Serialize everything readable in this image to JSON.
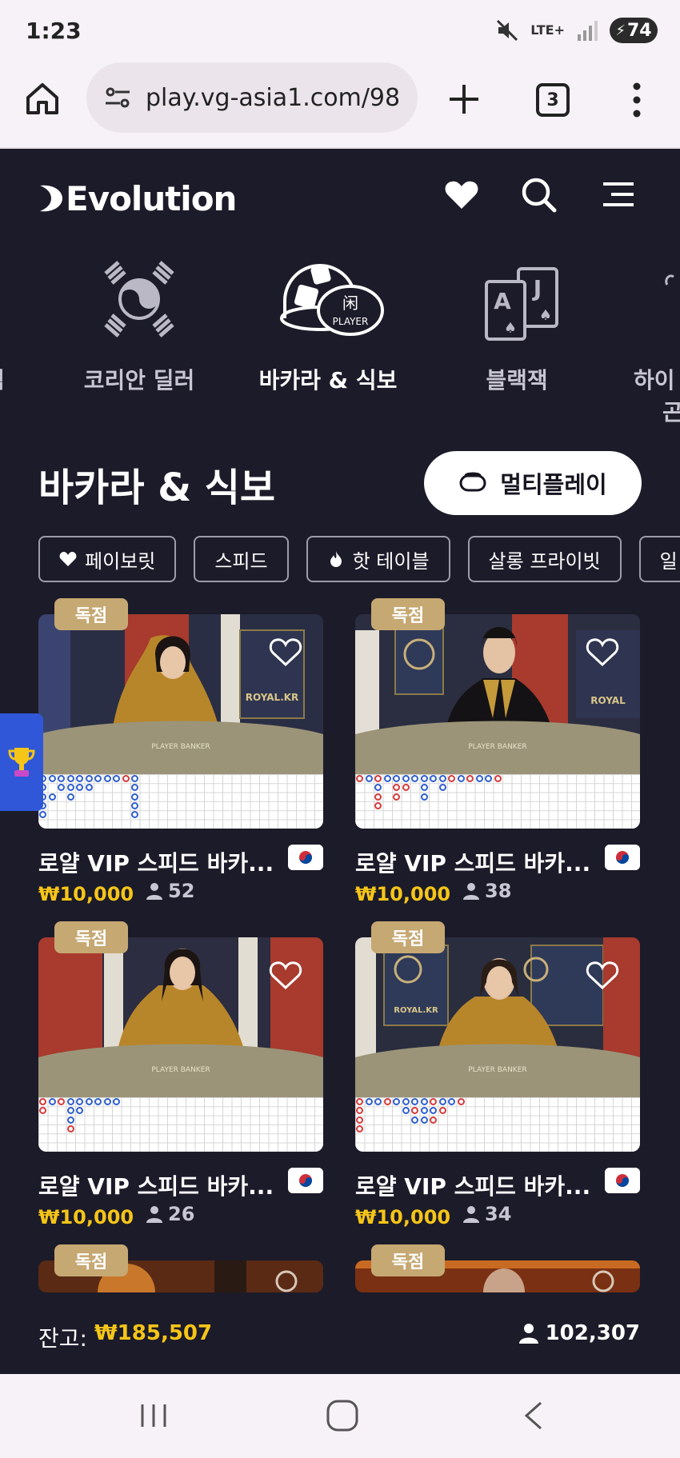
{
  "status_bar": {
    "time": "1:23",
    "network": "LTE+",
    "battery": "74"
  },
  "browser": {
    "url": "play.vg-asia1.com/98",
    "tab_count": "3"
  },
  "header": {
    "brand": "Evolution"
  },
  "categories": [
    {
      "label": "임",
      "icon": "partial-icon"
    },
    {
      "label": "코리안 딜러",
      "icon": "taegeuk-icon"
    },
    {
      "label": "바카라 & 식보",
      "icon": "dice-baccarat-icon",
      "active": true
    },
    {
      "label": "블랙잭",
      "icon": "cards-icon"
    },
    {
      "label": "하이",
      "label2": "곤",
      "icon": "partial-icon"
    }
  ],
  "section": {
    "title": "바카라 & 식보",
    "multiplay": "멀티플레이"
  },
  "filters": [
    "페이보릿",
    "스피드",
    "핫 테이블",
    "살롱 프라이빗",
    "일"
  ],
  "tables": [
    {
      "badge": "독점",
      "title": "로얄 VIP 스피드 바카...",
      "min_bet": "₩10,000",
      "players": "52",
      "studio_sign": "ROYAL.KR",
      "table_text": "PLAYER  BANKER"
    },
    {
      "badge": "독점",
      "title": "로얄 VIP 스피드 바카...",
      "min_bet": "₩10,000",
      "players": "38",
      "studio_sign": "ROYAL",
      "table_text": "PLAYER  BANKER"
    },
    {
      "badge": "독점",
      "title": "로얄 VIP 스피드 바카...",
      "min_bet": "₩10,000",
      "players": "26",
      "studio_sign": "",
      "table_text": "PLAYER  BANKER"
    },
    {
      "badge": "독점",
      "title": "로얄 VIP 스피드 바카...",
      "min_bet": "₩10,000",
      "players": "34",
      "studio_sign": "ROYAL.KR",
      "table_text": "PLAYER  BANKER"
    },
    {
      "badge": "독점"
    },
    {
      "badge": "독점"
    }
  ],
  "footer": {
    "balance_label": "잔고:",
    "balance": "₩185,507",
    "online_players": "102,307"
  },
  "colors": {
    "background": "#1c1b29",
    "accent_gold": "#f5c518",
    "badge": "#c6a873",
    "player_bead": "#2f5fd0",
    "banker_bead": "#d63a3a",
    "side_tab": "#2f57d7"
  }
}
